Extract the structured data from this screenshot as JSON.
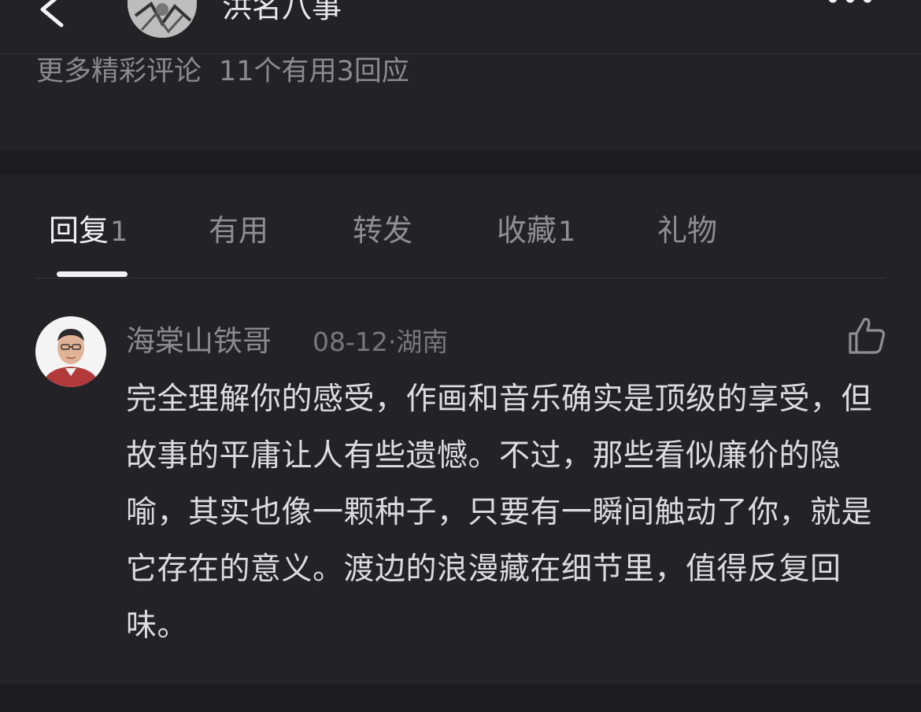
{
  "header": {
    "title": "洪名八事",
    "back_icon": "chevron-left-icon",
    "more_icon": "more-dots-icon"
  },
  "more_comments": {
    "label": "更多精彩评论",
    "stats": "11个有用3回应"
  },
  "tabs": [
    {
      "label": "回复",
      "count": "1",
      "active": true
    },
    {
      "label": "有用",
      "count": "",
      "active": false
    },
    {
      "label": "转发",
      "count": "",
      "active": false
    },
    {
      "label": "收藏",
      "count": "1",
      "active": false
    },
    {
      "label": "礼物",
      "count": "",
      "active": false
    }
  ],
  "reply": {
    "author": "海棠山铁哥",
    "meta": "08-12·湖南",
    "text": "完全理解你的感受，作画和音乐确实是顶级的享受，但故事的平庸让人有些遗憾。不过，那些看似廉价的隐喻，其实也像一颗种子，只要有一瞬间触动了你，就是它存在的意义。渡边的浪漫藏在细节里，值得反复回味。",
    "like_icon": "thumbs-up-icon"
  },
  "colors": {
    "background": "#1c1c1f",
    "card": "#232327",
    "text_primary": "#f2f2f4",
    "text_secondary": "#8e8e93"
  }
}
